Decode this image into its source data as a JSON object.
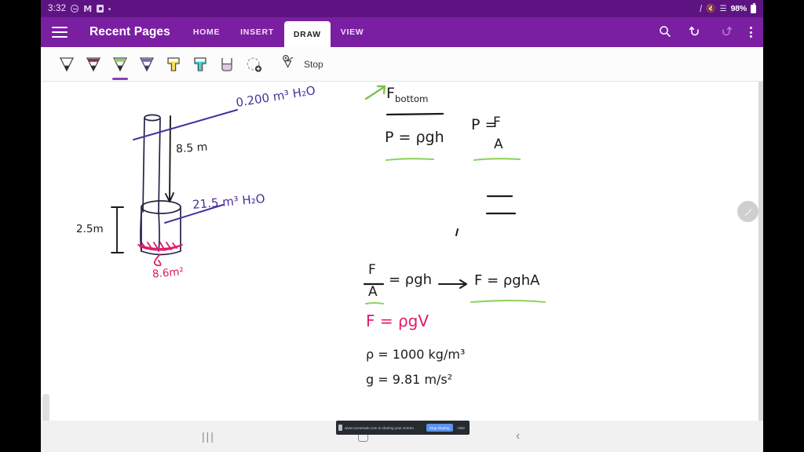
{
  "statusbar": {
    "time": "3:32",
    "icons": [
      "do-not-disturb-icon",
      "messages-icon",
      "screen-record-icon",
      "more-dot-icon"
    ],
    "right_icons": [
      "slash-icon",
      "mute-icon",
      "wifi-icon"
    ],
    "battery_percent": "98%"
  },
  "appbar": {
    "menu_icon": "hamburger-menu-icon",
    "title": "Recent Pages",
    "tabs": [
      {
        "label": "HOME",
        "active": false
      },
      {
        "label": "INSERT",
        "active": false
      },
      {
        "label": "DRAW",
        "active": true
      },
      {
        "label": "VIEW",
        "active": false
      }
    ],
    "actions": [
      {
        "name": "search-icon",
        "glyph": "⌕"
      },
      {
        "name": "undo-icon",
        "glyph": "↶"
      },
      {
        "name": "redo-icon",
        "glyph": "↷"
      },
      {
        "name": "overflow-menu-icon",
        "glyph": "⋮"
      }
    ]
  },
  "pentoolbar": {
    "pens": [
      {
        "name": "pen-black",
        "color": "#2b2b2b",
        "selected": false
      },
      {
        "name": "pen-maroon",
        "color": "#8e2c4f",
        "selected": false
      },
      {
        "name": "pen-green",
        "color": "#7dc24b",
        "selected": true
      },
      {
        "name": "pen-purple",
        "color": "#6b4fc4",
        "selected": false
      },
      {
        "name": "highlighter-yellow",
        "color": "#f6e14c",
        "selected": false
      },
      {
        "name": "highlighter-cyan",
        "color": "#3fd3e0",
        "selected": false
      },
      {
        "name": "eraser-pink",
        "color": "#e5c7e2",
        "selected": false
      }
    ],
    "add_pen_label": "add-pen-icon",
    "lasso_icon": "lasso-select-icon",
    "stop_label": "Stop"
  },
  "canvas": {
    "fab_icon": "edit-pen-fab-icon",
    "scrollbar": "left-scrollbar-handle",
    "notes": {
      "diagram": [
        {
          "id": "volume-top-label",
          "text": "0.200 m³ H₂O",
          "color": "purple"
        },
        {
          "id": "height-label",
          "text": "8.5 m",
          "color": "black"
        },
        {
          "id": "tank-height-label",
          "text": "2.5m",
          "color": "black"
        },
        {
          "id": "volume-tank-label",
          "text": "21.5 m³ H₂O",
          "color": "purple"
        },
        {
          "id": "area-label",
          "text": "8.6m²",
          "color": "pink"
        }
      ],
      "work": [
        {
          "id": "title",
          "text": "F bottom",
          "color": "black"
        },
        {
          "id": "eq-pressure-depth",
          "text": "P = ρgh",
          "color": "black"
        },
        {
          "id": "eq-pressure-force",
          "text": "P = F / A",
          "color": "black"
        },
        {
          "id": "eq-combined",
          "text": "F/A = ρgh → F = ρghA",
          "color": "black"
        },
        {
          "id": "eq-force-volume",
          "text": "F = ρgV",
          "color": "pink"
        },
        {
          "id": "const-density",
          "text": "ρ = 1000 kg/m³",
          "color": "black"
        },
        {
          "id": "const-gravity",
          "text": "g = 9.81 m/s²",
          "color": "black"
        }
      ]
    }
  },
  "share_toast": {
    "message": "www.numerade.com is sharing your screen.",
    "stop_label": "Stop sharing",
    "hide_label": "Hide"
  },
  "navbar": {
    "recents_label": "|||",
    "home_label": "home-button",
    "back_label": "‹"
  },
  "colors": {
    "statusbar_bg": "#5d1482",
    "appbar_bg": "#7b1fa2",
    "accent": "#7b1fa2",
    "ink_black": "#1b1b1b",
    "ink_purple": "#4b2f9c",
    "ink_pink": "#e01b6a",
    "ink_green": "#7dc24b"
  }
}
